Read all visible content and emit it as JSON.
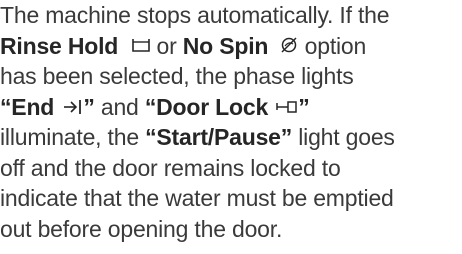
{
  "paragraph": {
    "line1": "The machine stops automatically. If the",
    "rinse_hold": "Rinse Hold",
    "or1": " or ",
    "no_spin": "No Spin",
    "option": " option",
    "line3": "has been selected, the phase lights",
    "end_label": "“End",
    "end_close": "”",
    "and": " and ",
    "door_lock_label": "“Door Lock",
    "door_lock_close": "”",
    "illuminate": "illuminate, the ",
    "start_pause": "“Start/Pause”",
    "light_goes": " light goes",
    "line6": "off and the door remains locked to",
    "line7": "indicate that the water must be emptied",
    "line8": "out before opening the door."
  },
  "icons": {
    "rinse_hold": "rinse-hold-icon",
    "no_spin": "no-spin-icon",
    "end": "end-arrow-icon",
    "door_lock": "door-lock-icon"
  }
}
